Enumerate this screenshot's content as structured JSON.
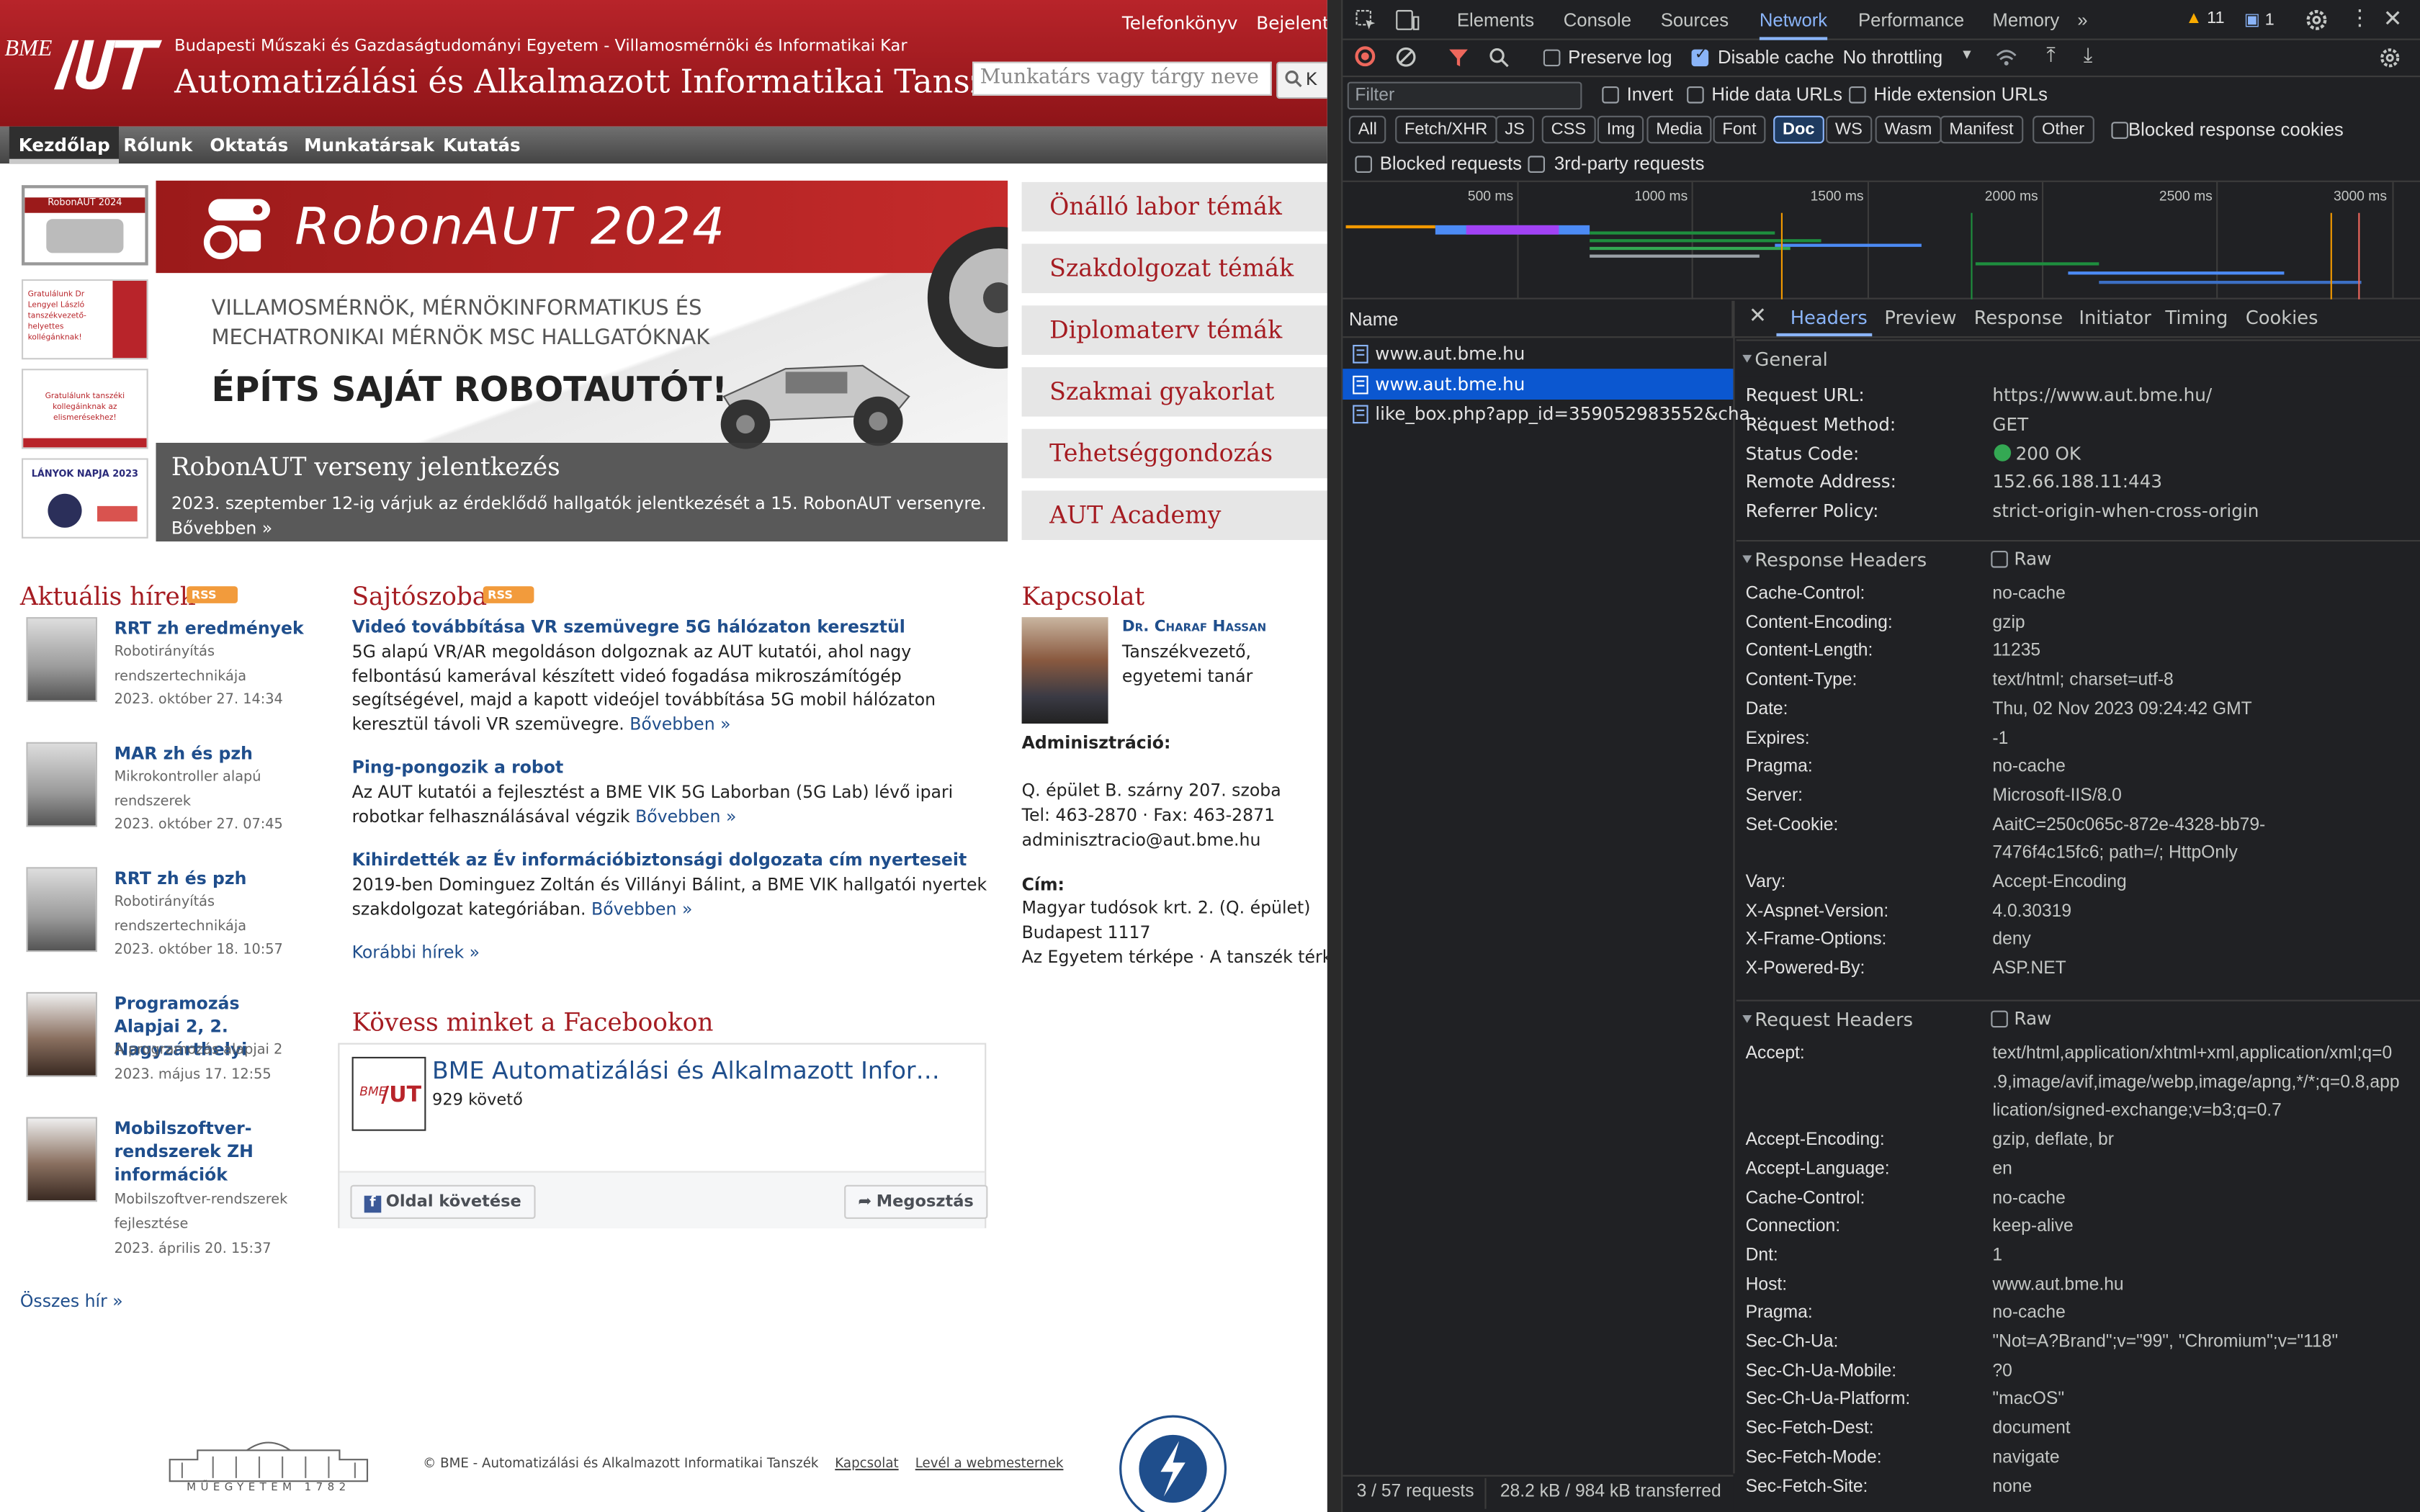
{
  "site": {
    "university": "Budapesti Műszaki és Gazdaságtudományi Egyetem - Villamosmérnöki és Informatikai Kar",
    "department": "Automatizálási és Alkalmazott Informatikai Tanszék",
    "top_links": [
      "Telefonkönyv",
      "Bejelent"
    ],
    "search_placeholder": "Munkatárs vagy tárgy neve",
    "search_button": "K",
    "nav": [
      "Kezdőlap",
      "Rólunk",
      "Oktatás",
      "Munkatársak",
      "Kutatás"
    ],
    "thumbs": [
      "RobonAUT 2024",
      "Gratulálunk Dr Lengyel László tanszékvezető-helyettes kollégánknak!",
      "Gratulálunk tanszéki kollegáinknak az elismerésekhez!",
      "LÁNYOK NAPJA 2023"
    ],
    "banner": {
      "robon": "RobonAUT 2024",
      "sub": "VILLAMOSMÉRNÖK, MÉRNÖKINFORMATIKUS ÉS MECHATRONIKAI MÉRNÖK MSC HALLGATÓKNAK",
      "build": "ÉPÍTS SAJÁT ROBOTAUTÓT!",
      "caption_title": "RobonAUT verseny jelentkezés",
      "caption_text": "2023. szeptember 12-ig várjuk az érdeklődő hallgatók jelentkezését a 15. RobonAUT versenyre.",
      "caption_more": "Bővebben »"
    },
    "quick_links": [
      "Önálló labor témák",
      "Szakdolgozat témák",
      "Diplomaterv témák",
      "Szakmai gyakorlat",
      "Tehetséggondozás",
      "AUT Academy"
    ],
    "news_title": "Aktuális hírek",
    "rss": "RSS",
    "news": [
      {
        "title": "RRT zh eredmények",
        "sub": "Robotirányítás rendszertechnikája",
        "date": "2023. október 27. 14:34"
      },
      {
        "title": "MAR zh és pzh",
        "sub": "Mikrokontroller alapú rendszerek",
        "date": "2023. október 27. 07:45"
      },
      {
        "title": "RRT zh és pzh",
        "sub": "Robotirányítás rendszertechnikája",
        "date": "2023. október 18. 10:57"
      },
      {
        "title": "Programozás Alapjai 2, 2. Nagyzárthelyi",
        "sub": "A programozás alapjai 2",
        "date": "2023. május 17. 12:55"
      },
      {
        "title": "Mobilszoftver-rendszerek ZH információk",
        "sub": "Mobilszoftver-rendszerek fejlesztése",
        "date": "2023. április 20. 15:37"
      }
    ],
    "all_news": "Összes hír »",
    "press_title": "Sajtószoba",
    "press": [
      {
        "title": "Videó továbbítása VR szemüvegre 5G hálózaton keresztül",
        "text": "5G alapú VR/AR megoldáson dolgoznak az AUT kutatói, ahol nagy felbontású kamerával készített videó fogadása mikroszámítógép segítségével, majd a kapott videójel továbbítása 5G mobil hálózaton keresztül távoli VR szemüvegre.",
        "more": "Bővebben »"
      },
      {
        "title": "Ping-pongozik a robot",
        "text": "Az AUT kutatói a fejlesztést a BME VIK 5G Laborban (5G Lab) lévő ipari robotkar felhasználásával végzik",
        "more": "Bővebben »"
      },
      {
        "title": "Kihirdették az Év információbiztonsági dolgozata cím nyerteseit",
        "text": "2019-ben Dominguez Zoltán és Villányi Bálint, a BME VIK hallgatói nyertek szakdolgozat kategóriában.",
        "more": "Bővebben »"
      }
    ],
    "older_news": "Korábbi hírek »",
    "fb_title": "Kövess minket a Facebookon",
    "fb_page": "BME Automatizálási és Alkalmazott Infor…",
    "fb_followers": "929 követő",
    "fb_follow": "Oldal követése",
    "fb_share": "Megosztás",
    "contact_title": "Kapcsolat",
    "contact_name": "Dr. Charaf Hassan",
    "contact_role1": "Tanszékvezető,",
    "contact_role2": "egyetemi tanár",
    "admin_label": "Adminisztráció:",
    "admin_room": "Q. épület B. szárny 207. szoba",
    "admin_phone": "Tel: 463-2870 · Fax: 463-2871",
    "admin_email": "adminisztracio@aut.bme.hu",
    "address_label": "Cím:",
    "address1": "Magyar tudósok krt. 2. (Q. épület)",
    "address2": "Budapest 1117",
    "map_links": "Az Egyetem térképe · A tanszék térké",
    "footer_text": "© BME - Automatizálási és Alkalmazott Informatikai Tanszék",
    "footer_contact": "Kapcsolat",
    "footer_webmaster": "Levél a webmesternek",
    "footer_logo_text": "MŰEGYETEM 1782"
  },
  "devtools": {
    "tabs": [
      "Elements",
      "Console",
      "Sources",
      "Network",
      "Performance",
      "Memory"
    ],
    "active_tab": "Network",
    "warnings": "11",
    "messages": "1",
    "preserve_log": "Preserve log",
    "disable_cache": "Disable cache",
    "throttling": "No throttling",
    "filter_placeholder": "Filter",
    "invert": "Invert",
    "hide_data_urls": "Hide data URLs",
    "hide_ext_urls": "Hide extension URLs",
    "type_filters": [
      "All",
      "Fetch/XHR",
      "JS",
      "CSS",
      "Img",
      "Media",
      "Font",
      "Doc",
      "WS",
      "Wasm",
      "Manifest",
      "Other"
    ],
    "active_type": "Doc",
    "blocked_cookies": "Blocked response cookies",
    "blocked_requests": "Blocked requests",
    "third_party": "3rd-party requests",
    "timeline_ticks": [
      "500 ms",
      "1000 ms",
      "1500 ms",
      "2000 ms",
      "2500 ms",
      "3000 ms"
    ],
    "name_header": "Name",
    "requests": [
      "www.aut.bme.hu",
      "www.aut.bme.hu",
      "like_box.php?app_id=359052983552&cha…"
    ],
    "detail_tabs": [
      "Headers",
      "Preview",
      "Response",
      "Initiator",
      "Timing",
      "Cookies"
    ],
    "general_title": "General",
    "general": [
      [
        "Request URL:",
        "https://www.aut.bme.hu/"
      ],
      [
        "Request Method:",
        "GET"
      ],
      [
        "Status Code:",
        "200 OK"
      ],
      [
        "Remote Address:",
        "152.66.188.11:443"
      ],
      [
        "Referrer Policy:",
        "strict-origin-when-cross-origin"
      ]
    ],
    "response_title": "Response Headers",
    "raw": "Raw",
    "response": [
      [
        "Cache-Control:",
        "no-cache"
      ],
      [
        "Content-Encoding:",
        "gzip"
      ],
      [
        "Content-Length:",
        "11235"
      ],
      [
        "Content-Type:",
        "text/html; charset=utf-8"
      ],
      [
        "Date:",
        "Thu, 02 Nov 2023 09:24:42 GMT"
      ],
      [
        "Expires:",
        "-1"
      ],
      [
        "Pragma:",
        "no-cache"
      ],
      [
        "Server:",
        "Microsoft-IIS/8.0"
      ],
      [
        "Set-Cookie:",
        "AaitC=250c065c-872e-4328-bb79-"
      ],
      [
        "",
        "7476f4c15fc6; path=/; HttpOnly"
      ],
      [
        "Vary:",
        "Accept-Encoding"
      ],
      [
        "X-Aspnet-Version:",
        "4.0.30319"
      ],
      [
        "X-Frame-Options:",
        "deny"
      ],
      [
        "X-Powered-By:",
        "ASP.NET"
      ]
    ],
    "request_title": "Request Headers",
    "request": [
      [
        "Accept:",
        "text/html,application/xhtml+xml,application/xml;q=0"
      ],
      [
        "",
        ".9,image/avif,image/webp,image/apng,*/*;q=0.8,app"
      ],
      [
        "",
        "lication/signed-exchange;v=b3;q=0.7"
      ],
      [
        "Accept-Encoding:",
        "gzip, deflate, br"
      ],
      [
        "Accept-Language:",
        "en"
      ],
      [
        "Cache-Control:",
        "no-cache"
      ],
      [
        "Connection:",
        "keep-alive"
      ],
      [
        "Dnt:",
        "1"
      ],
      [
        "Host:",
        "www.aut.bme.hu"
      ],
      [
        "Pragma:",
        "no-cache"
      ],
      [
        "Sec-Ch-Ua:",
        "\"Not=A?Brand\";v=\"99\", \"Chromium\";v=\"118\""
      ],
      [
        "Sec-Ch-Ua-Mobile:",
        "?0"
      ],
      [
        "Sec-Ch-Ua-Platform:",
        "\"macOS\""
      ],
      [
        "Sec-Fetch-Dest:",
        "document"
      ],
      [
        "Sec-Fetch-Mode:",
        "navigate"
      ],
      [
        "Sec-Fetch-Site:",
        "none"
      ]
    ],
    "status_requests": "3 / 57 requests",
    "status_transfer": "28.2 kB / 984 kB transferred"
  }
}
